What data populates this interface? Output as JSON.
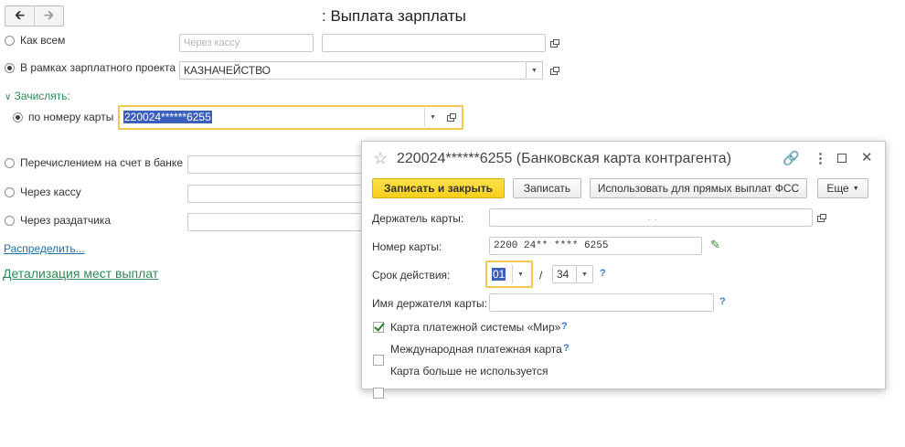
{
  "page": {
    "title": ": Выплата зарплаты",
    "nav": {
      "back_icon": "arrow-left-icon",
      "forward_icon": "arrow-right-icon"
    }
  },
  "payment": {
    "option_all": {
      "label": "Как всем",
      "field1_placeholder": "Через кассу",
      "field2_value": ""
    },
    "option_project": {
      "label": "В рамках зарплатного проекта",
      "value": "КАЗНАЧЕЙСТВО"
    },
    "credit_section": "Зачислять:",
    "by_card": {
      "label": "по номеру карты",
      "value": "220024******6255"
    },
    "option_bank": {
      "label": "Перечислением на счет в банке"
    },
    "option_cash": {
      "label": "Через кассу"
    },
    "option_distributor": {
      "label": "Через раздатчика"
    },
    "distribute_link": "Распределить...",
    "details_link": "Детализация мест выплат"
  },
  "dialog": {
    "title": "220024******6255 (Банковская карта контрагента)",
    "buttons": {
      "save_close": "Записать и закрыть",
      "save": "Записать",
      "use_fss": "Использовать для прямых выплат ФСС",
      "more": "Еще"
    },
    "holder_label": "Держатель карты:",
    "holder_value": ". .",
    "card_number_label": "Номер карты:",
    "card_number_value": "2200 24** **** 6255",
    "validity_label": "Срок действия:",
    "validity_month": "01",
    "validity_sep": "/",
    "validity_year": "34",
    "holder_name_label": "Имя держателя карты:",
    "holder_name_value": "",
    "help_mark": "?",
    "checkbox_mir": {
      "label": "Карта платежной системы «Мир»",
      "checked": true
    },
    "checkbox_international": {
      "label": "Международная платежная карта",
      "checked": false
    },
    "checkbox_unused": {
      "label": "Карта больше не используется",
      "checked": false
    }
  },
  "colors": {
    "primary_button": "#f7cf1b",
    "focus_frame": "#f2c94c",
    "link_green": "#2e8b57",
    "link_blue": "#1f6fa8",
    "selection": "#3b5fbd"
  }
}
